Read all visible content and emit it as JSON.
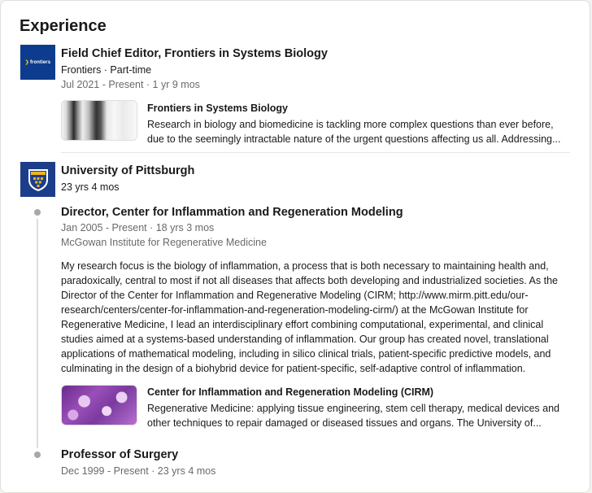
{
  "section": {
    "title": "Experience"
  },
  "frontiers": {
    "logo_text": "frontiers",
    "title": "Field Chief Editor, Frontiers in Systems Biology",
    "company": "Frontiers · Part-time",
    "dates": "Jul 2021 - Present · 1 yr 9 mos",
    "media": {
      "title": "Frontiers in Systems Biology",
      "desc_line1": "Research in biology and biomedicine is tackling more complex questions than ever before,",
      "desc_line2": "due to the seemingly intractable nature of the urgent questions affecting us all. Addressing..."
    }
  },
  "pitt": {
    "name": "University of Pittsburgh",
    "duration": "23 yrs 4 mos",
    "roles": [
      {
        "title": "Director, Center for Inflammation and Regeneration Modeling",
        "dates": "Jan 2005 - Present · 18 yrs 3 mos",
        "location": "McGowan Institute for Regenerative Medicine",
        "description_lines": [
          "My research focus is the biology of inflammation, a process that is both necessary to maintaining health and,",
          "paradoxically, central to most if not all diseases that affects both developing and industrialized societies. As the",
          "Director of the Center for Inflammation and Regenerative Modeling (CIRM; http://www.mirm.pitt.edu/our-",
          "research/centers/center-for-inflammation-and-regeneration-modeling-cirm/) at the McGowan Institute for",
          "Regenerative Medicine, I lead an interdisciplinary effort combining computational, experimental, and clinical",
          "studies aimed at a systems-based understanding of inflammation. Our group has created novel, translational",
          "applications of mathematical modeling, including in silico clinical trials, patient-specific predictive models, and",
          "culminating in the design of a biohybrid device for patient-specific, self-adaptive control of inflammation."
        ],
        "media": {
          "title": "Center for Inflammation and Regeneration Modeling (CIRM)",
          "desc_line1": "Regenerative Medicine: applying tissue engineering, stem cell therapy, medical devices and",
          "desc_line2": "other techniques to repair damaged or diseased tissues and organs. The University of..."
        }
      },
      {
        "title": "Professor of Surgery",
        "dates": "Dec 1999 - Present · 23 yrs 4 mos"
      }
    ]
  },
  "colors": {
    "frontiers_logo_bg": "#0d3b8e",
    "pitt_logo_bg": "#1c3e8a",
    "pitt_gold": "#f0b323"
  }
}
